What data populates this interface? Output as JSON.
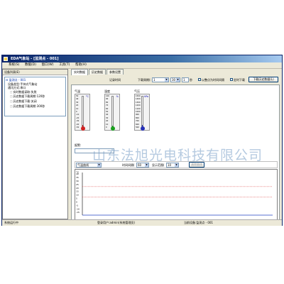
{
  "window": {
    "title": "EDA气象站 - [监测点 - 001]"
  },
  "menu": [
    "系统(S)",
    "数据(D)",
    "窗口(W)",
    "工具(T)",
    "帮助(H)"
  ],
  "left_panel": {
    "header": "设备列表(E)",
    "tree": {
      "root": "监测点 - 001",
      "items": [
        "设备类型:手持式气象站",
        "通讯方式:串口",
        "实时数据读取:失败",
        "历史数据下载周期:120秒",
        "历史数据下载:关闭",
        "历史数据下载周期:300秒"
      ]
    }
  },
  "tabs": [
    "实时数据",
    "历史数据",
    "参数设置"
  ],
  "toolbar": {
    "record_label": "记录时间",
    "period_label": "下载周期(:",
    "period_value": "1",
    "period_value2": "30",
    "sec_value": "1",
    "unit": "秒",
    "check1_label": "以整点为时间间隔",
    "check2_label": "定时下载",
    "download_button": "下载历史数据(L)"
  },
  "gauges": [
    {
      "name": "气温",
      "unit": "°C",
      "ticks": [
        "50",
        "40",
        "30",
        "20",
        "10",
        "0",
        "-10",
        "-20",
        "-30",
        "-40",
        "-50"
      ],
      "bulb_color": "#d22222",
      "liquid_color": "#d22222",
      "level": 0.05
    },
    {
      "name": "湿度",
      "unit": "%",
      "ticks": [
        "100",
        "90",
        "80",
        "70",
        "60",
        "50",
        "40",
        "30",
        "20",
        "10",
        "0"
      ],
      "bulb_color": "#19a01d",
      "liquid_color": "#19a01d",
      "level": 0.03
    },
    {
      "name": "气压",
      "unit": "hPa",
      "ticks": [
        "1500",
        "1400",
        "1300",
        "1200",
        "1100",
        "1000",
        "900",
        "800",
        "700",
        "600",
        "500"
      ],
      "bulb_color": "#2630b8",
      "liquid_color": "#2630b8",
      "level": 0.04
    }
  ],
  "alarm_label": "报警:",
  "chart_controls": {
    "select1": "气温曲线",
    "label2": "时间间隔(",
    "select2": "60",
    "label3": "显示范围(",
    "select3": "10",
    "button": "清除曲线"
  },
  "chart_data": {
    "type": "line",
    "yaxis_ticks": [
      "40",
      "35",
      "30",
      "25",
      "20",
      "15",
      "10",
      "5",
      "0",
      "-5",
      "-10",
      "-15"
    ],
    "unit": "°C",
    "threshold_color": "#e05050"
  },
  "status_bar": {
    "left": "系统运行中",
    "middle": "登录用户:admin(系统管理员)",
    "right": "当前设备:监测点 - 001"
  },
  "watermark": "山东法旭光电科技有限公司"
}
